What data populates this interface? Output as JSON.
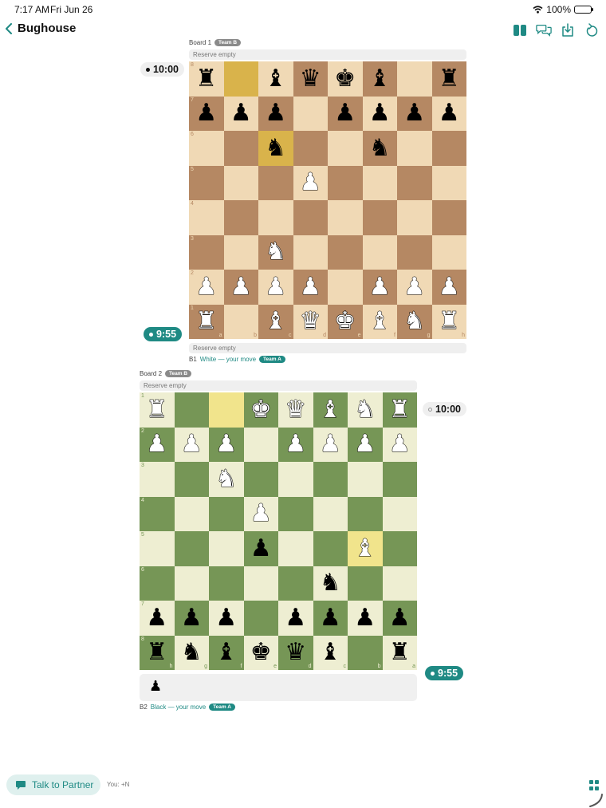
{
  "status": {
    "time": "7:17 AM",
    "date": "Fri Jun 26",
    "battery": "100%"
  },
  "nav": {
    "back_icon": "chevron-left-icon",
    "title": "Bughouse",
    "tools": [
      "split-view-icon",
      "chat-bubbles-icon",
      "download-icon",
      "undo-icon"
    ]
  },
  "colors": {
    "accent": "#1f8a84",
    "wood_light": "#f0d9b5",
    "wood_dark": "#b58863",
    "wood_highlight": "#d9b34b",
    "green_light": "#eeeed2",
    "green_dark": "#769656",
    "green_highlight": "#f1e48c"
  },
  "board1": {
    "label": "Board 1",
    "team_badge": "Team B",
    "reserve_top": "Reserve empty",
    "reserve_bottom": "Reserve empty",
    "opponent_clock": "10:00",
    "player_clock": "9:55",
    "move_board": "B1",
    "move_text": "White — your move",
    "move_team": "Team A",
    "ranks": [
      "8",
      "7",
      "6",
      "5",
      "4",
      "3",
      "2",
      "1"
    ],
    "files": [
      "a",
      "b",
      "c",
      "d",
      "e",
      "f",
      "g",
      "h"
    ],
    "rows": [
      [
        "br",
        "",
        "bb",
        "bq",
        "bk",
        "bb",
        "",
        "br"
      ],
      [
        "bp",
        "bp",
        "bp",
        "",
        "bp",
        "bp",
        "bp",
        "bp"
      ],
      [
        "",
        "",
        "bn",
        "",
        "",
        "bn",
        "",
        ""
      ],
      [
        "",
        "",
        "",
        "wp",
        "",
        "",
        "",
        ""
      ],
      [
        "",
        "",
        "",
        "",
        "",
        "",
        "",
        ""
      ],
      [
        "",
        "",
        "wn",
        "",
        "",
        "",
        "",
        ""
      ],
      [
        "wp",
        "wp",
        "wp",
        "wp",
        "",
        "wp",
        "wp",
        "wp"
      ],
      [
        "wr",
        "",
        "wb",
        "wq",
        "wk",
        "wb",
        "wn",
        "wr"
      ]
    ],
    "highlights": [
      "0-1",
      "2-2"
    ]
  },
  "board2": {
    "label": "Board 2",
    "team_badge": "Team B",
    "reserve_top": "Reserve empty",
    "reserve_bottom_piece": "bp",
    "opponent_clock": "10:00",
    "player_clock": "9:55",
    "move_board": "B2",
    "move_text": "Black — your move",
    "move_team": "Team A",
    "ranks": [
      "1",
      "2",
      "3",
      "4",
      "5",
      "6",
      "7",
      "8"
    ],
    "files": [
      "h",
      "g",
      "f",
      "e",
      "d",
      "c",
      "b",
      "a"
    ],
    "rows": [
      [
        "wr",
        "",
        "",
        "wk",
        "wq",
        "wb",
        "wn",
        "wr"
      ],
      [
        "wp",
        "wp",
        "wp",
        "",
        "wp",
        "wp",
        "wp",
        "wp"
      ],
      [
        "",
        "",
        "wn",
        "",
        "",
        "",
        "",
        ""
      ],
      [
        "",
        "",
        "",
        "wp",
        "",
        "",
        "",
        ""
      ],
      [
        "",
        "",
        "",
        "bp",
        "",
        "",
        "wb",
        ""
      ],
      [
        "",
        "",
        "",
        "",
        "",
        "bn",
        "",
        ""
      ],
      [
        "bp",
        "bp",
        "bp",
        "",
        "bp",
        "bp",
        "bp",
        "bp"
      ],
      [
        "br",
        "bn",
        "bb",
        "bk",
        "bq",
        "bb",
        "",
        "br"
      ]
    ],
    "highlights": [
      "0-2",
      "4-6"
    ]
  },
  "footer": {
    "talk_label": "Talk to Partner",
    "talk_icon": "chat-icon",
    "you_text": "You: +N",
    "grid_icon": "grid-icon"
  }
}
